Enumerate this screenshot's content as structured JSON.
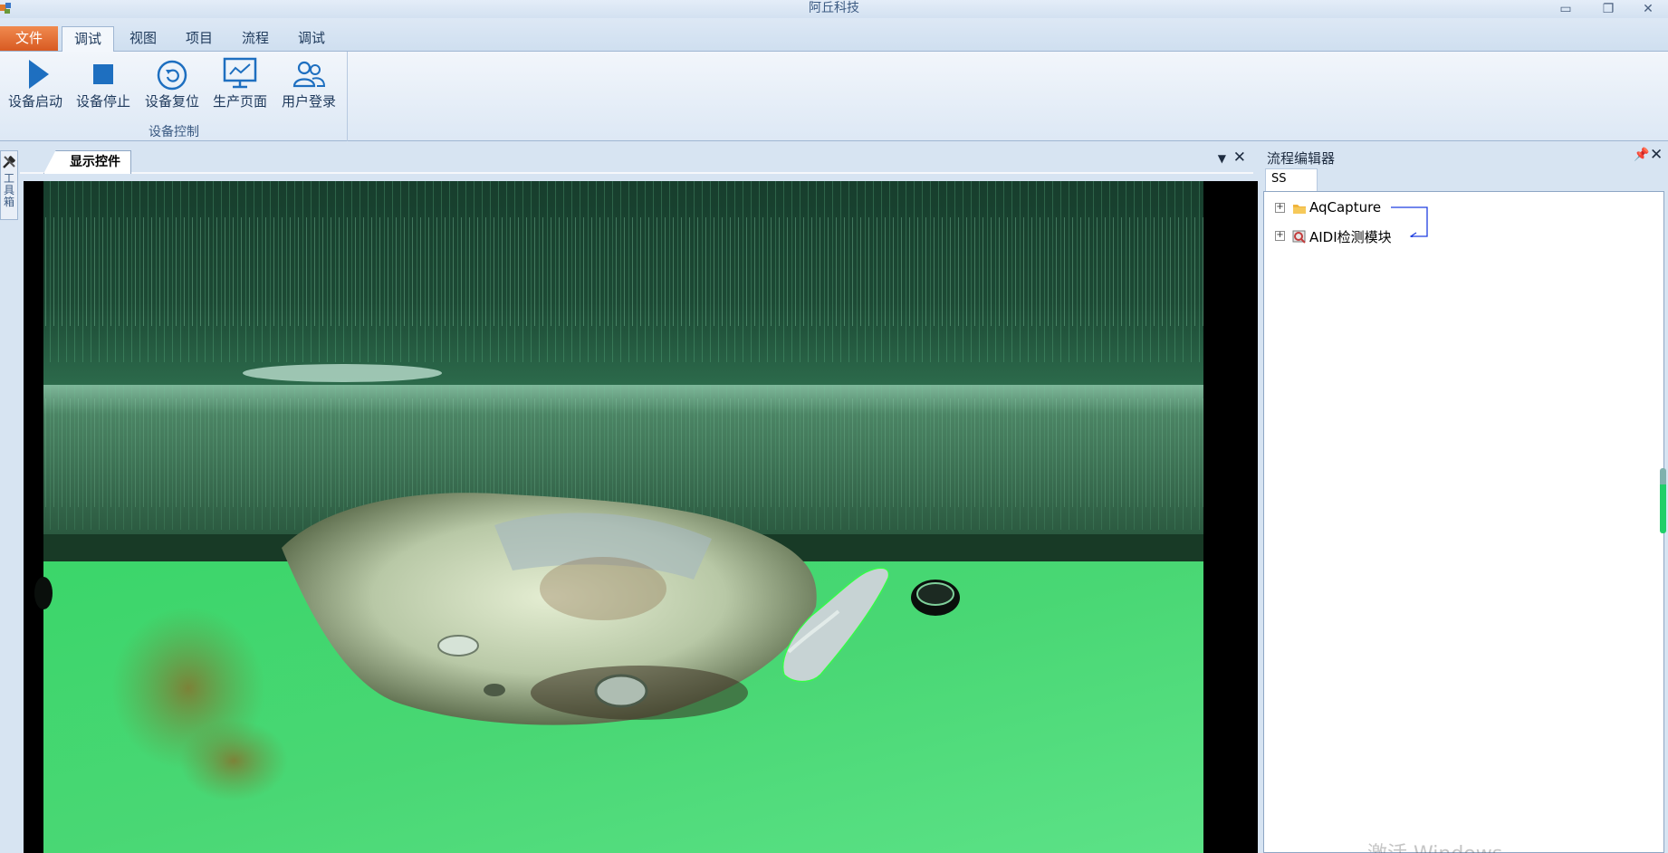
{
  "window": {
    "title": "阿丘科技",
    "minimize_icon": "minimize-icon",
    "restore_icon": "restore-icon",
    "close_icon": "close-icon"
  },
  "menu": {
    "file_tab": "文件",
    "tabs": [
      {
        "label": "调试",
        "active": true
      },
      {
        "label": "视图",
        "active": false
      },
      {
        "label": "项目",
        "active": false
      },
      {
        "label": "流程",
        "active": false
      },
      {
        "label": "调试",
        "active": false
      }
    ]
  },
  "ribbon": {
    "group_label": "设备控制",
    "buttons": [
      {
        "label": "设备启动",
        "icon": "play-icon"
      },
      {
        "label": "设备停止",
        "icon": "stop-icon"
      },
      {
        "label": "设备复位",
        "icon": "reset-icon"
      },
      {
        "label": "生产页面",
        "icon": "monitor-chart-icon"
      },
      {
        "label": "用户登录",
        "icon": "users-icon"
      }
    ]
  },
  "toolbox": {
    "label": "工具箱",
    "icon": "tools-icon"
  },
  "document": {
    "tab_label": "显示控件",
    "image_desc_colors": {
      "liquid": "#3fcf6a",
      "defect_outline": "#33ff44"
    }
  },
  "flow_editor": {
    "title": "流程编辑器",
    "tab_label": "SS",
    "nodes": [
      {
        "label": "AqCapture",
        "icon": "folder-icon"
      },
      {
        "label": "AIDI检测模块",
        "icon": "module-icon"
      }
    ],
    "connector_color": "#1f3fe0"
  },
  "overlay": {
    "watermark": "激活 Windows"
  },
  "colors": {
    "accent": "#d85a22",
    "ribbon_blue": "#1e6fc0"
  }
}
